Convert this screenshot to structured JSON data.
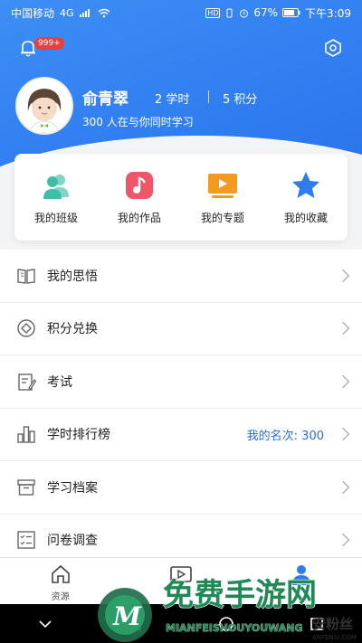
{
  "status": {
    "carrier": "中国移动",
    "network": "4G",
    "battery": "67%",
    "time": "下午3:09"
  },
  "header": {
    "notification_count": "999+",
    "username": "俞青翠",
    "hours_value": "2",
    "hours_unit": "学时",
    "points_value": "5",
    "points_unit": "积分",
    "online_text": "300 人在与你同时学习"
  },
  "quick": [
    {
      "label": "我的班级",
      "icon": "class-icon",
      "color": "#3dbfa5"
    },
    {
      "label": "我的作品",
      "icon": "music-icon",
      "color": "#f0566a"
    },
    {
      "label": "我的专题",
      "icon": "video-icon",
      "color": "#f39b1f"
    },
    {
      "label": "我的收藏",
      "icon": "star-icon",
      "color": "#2f7cf0"
    }
  ],
  "menu": [
    {
      "label": "我的思悟",
      "icon": "book-icon"
    },
    {
      "label": "积分兑换",
      "icon": "exchange-icon"
    },
    {
      "label": "考试",
      "icon": "exam-icon"
    },
    {
      "label": "学时排行榜",
      "icon": "ranking-icon",
      "value": "我的名次: 300"
    },
    {
      "label": "学习档案",
      "icon": "archive-icon"
    },
    {
      "label": "问卷调查",
      "icon": "survey-icon"
    }
  ],
  "tabs": [
    {
      "label": "资源",
      "icon": "home-icon"
    },
    {
      "label": "",
      "icon": "play-icon"
    },
    {
      "label": "",
      "icon": "user-icon"
    }
  ],
  "watermark": {
    "title": "免费手游网",
    "sub": "MIANFEISHOUYOUWANG",
    "sub2": "ANFENSI.COM",
    "brand": "安粉丝"
  }
}
